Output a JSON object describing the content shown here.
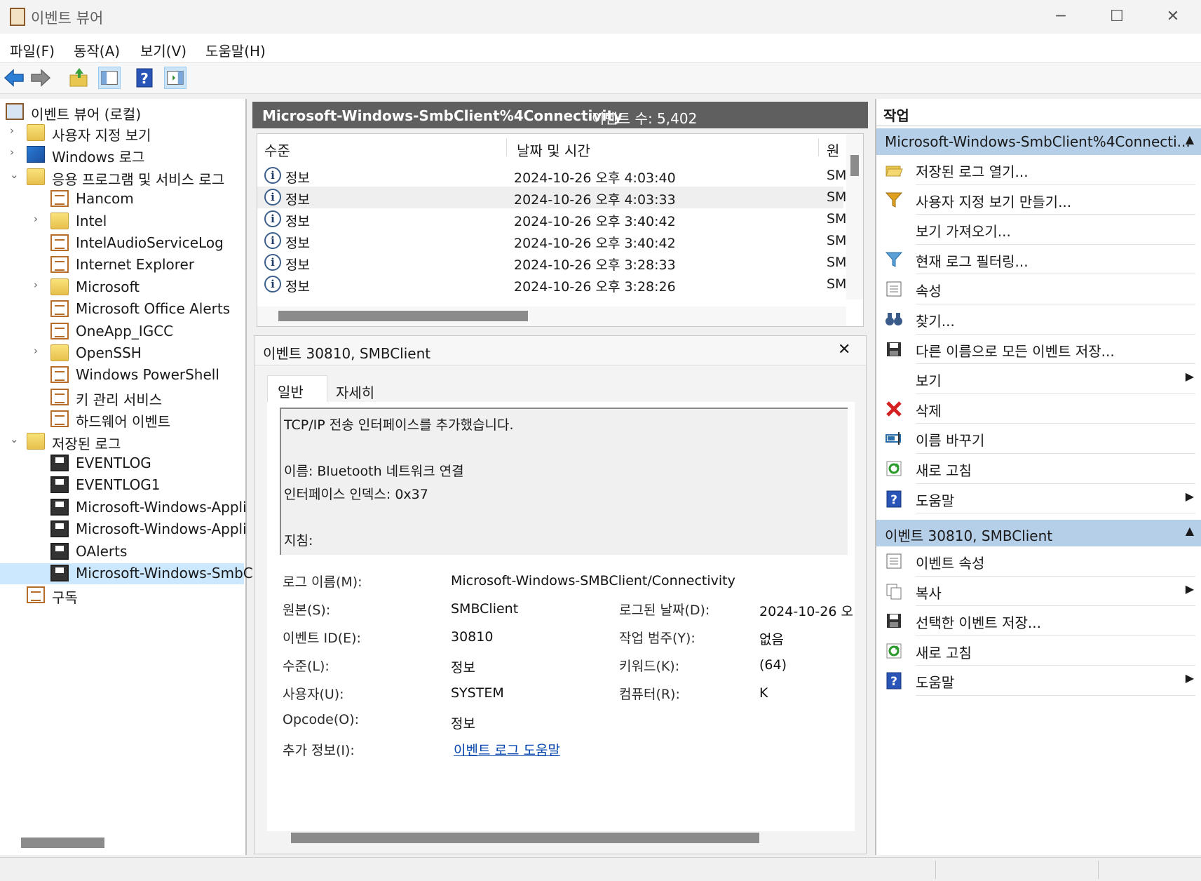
{
  "window": {
    "title": "이벤트 뷰어",
    "controls": [
      "─",
      "☐",
      "✕"
    ]
  },
  "menu": [
    "파일(F)",
    "동작(A)",
    "보기(V)",
    "도움말(H)"
  ],
  "tree": {
    "root": "이벤트 뷰어 (로컬)",
    "items": [
      {
        "label": "사용자 지정 보기",
        "expander": "›",
        "icon": "folder-icon"
      },
      {
        "label": "Windows 로그",
        "expander": "›",
        "icon": "windows-logs-icon"
      },
      {
        "label": "응용 프로그램 및 서비스 로그",
        "expander": "⌄",
        "icon": "folder-icon"
      },
      {
        "label": "Hancom",
        "expander": "",
        "icon": "log-icon"
      },
      {
        "label": "Intel",
        "expander": "›",
        "icon": "folder-icon"
      },
      {
        "label": "IntelAudioServiceLog",
        "expander": "",
        "icon": "log-icon"
      },
      {
        "label": "Internet Explorer",
        "expander": "",
        "icon": "log-icon"
      },
      {
        "label": "Microsoft",
        "expander": "›",
        "icon": "folder-icon"
      },
      {
        "label": "Microsoft Office Alerts",
        "expander": "",
        "icon": "log-icon"
      },
      {
        "label": "OneApp_IGCC",
        "expander": "",
        "icon": "log-icon"
      },
      {
        "label": "OpenSSH",
        "expander": "›",
        "icon": "folder-icon"
      },
      {
        "label": "Windows PowerShell",
        "expander": "",
        "icon": "log-icon"
      },
      {
        "label": "키 관리 서비스",
        "expander": "",
        "icon": "log-icon"
      },
      {
        "label": "하드웨어 이벤트",
        "expander": "",
        "icon": "log-icon"
      },
      {
        "label": "저장된 로그",
        "expander": "⌄",
        "icon": "folder-icon"
      },
      {
        "label": "EVENTLOG",
        "expander": "",
        "icon": "saved-log-icon"
      },
      {
        "label": "EVENTLOG1",
        "expander": "",
        "icon": "saved-log-icon"
      },
      {
        "label": "Microsoft-Windows-Appli",
        "expander": "",
        "icon": "saved-log-icon"
      },
      {
        "label": "Microsoft-Windows-Appli",
        "expander": "",
        "icon": "saved-log-icon"
      },
      {
        "label": "OAlerts",
        "expander": "",
        "icon": "saved-log-icon"
      },
      {
        "label": "Microsoft-Windows-SmbC",
        "expander": "",
        "icon": "saved-log-icon"
      },
      {
        "label": "구독",
        "expander": "",
        "icon": "subscriptions-icon"
      }
    ]
  },
  "log_header": {
    "name": "Microsoft-Windows-SmbClient%4Connectivity",
    "count": "이벤트 수: 5,402"
  },
  "grid": {
    "columns": [
      "수준",
      "날짜 및 시간",
      "원"
    ],
    "rows": [
      {
        "level": "정보",
        "datetime": "2024-10-26 오후 4:03:40",
        "source": "SM"
      },
      {
        "level": "정보",
        "datetime": "2024-10-26 오후 4:03:33",
        "source": "SM"
      },
      {
        "level": "정보",
        "datetime": "2024-10-26 오후 3:40:42",
        "source": "SM"
      },
      {
        "level": "정보",
        "datetime": "2024-10-26 오후 3:40:42",
        "source": "SM"
      },
      {
        "level": "정보",
        "datetime": "2024-10-26 오후 3:28:33",
        "source": "SM"
      },
      {
        "level": "정보",
        "datetime": "2024-10-26 오후 3:28:26",
        "source": "SM"
      }
    ]
  },
  "detail": {
    "title": "이벤트 30810, SMBClient",
    "close": "✕",
    "tabs": [
      "일반",
      "자세히"
    ],
    "message": [
      "TCP/IP 전송 인터페이스를 추가했습니다.",
      "",
      "이름: Bluetooth 네트워크 연결",
      "인터페이스 인덱스: 0x37",
      "",
      "지침:"
    ],
    "fields": {
      "log_name_label": "로그 이름(M):",
      "log_name": "Microsoft-Windows-SMBClient/Connectivity",
      "source_label": "원본(S):",
      "source": "SMBClient",
      "logged_label": "로그된 날짜(D):",
      "logged": "2024-10-26 오",
      "event_id_label": "이벤트 ID(E):",
      "event_id": "30810",
      "task_label": "작업 범주(Y):",
      "task": "없음",
      "level_label": "수준(L):",
      "level": "정보",
      "keywords_label": "키워드(K):",
      "keywords": "(64)",
      "user_label": "사용자(U):",
      "user": "SYSTEM",
      "computer_label": "컴퓨터(R):",
      "computer": "K",
      "opcode_label": "Opcode(O):",
      "opcode": "정보",
      "more_info_label": "추가 정보(I):",
      "more_info": "이벤트 로그 도움말"
    }
  },
  "actions": {
    "title": "작업",
    "section1": "Microsoft-Windows-SmbClient%4Connecti...",
    "items1": [
      {
        "label": "저장된 로그 열기...",
        "icon": "open-folder-icon",
        "arrow": ""
      },
      {
        "label": "사용자 지정 보기 만들기...",
        "icon": "filter-create-icon",
        "arrow": ""
      },
      {
        "label": "보기 가져오기...",
        "icon": "",
        "arrow": ""
      },
      {
        "label": "현재 로그 필터링...",
        "icon": "filter-icon",
        "arrow": ""
      },
      {
        "label": "속성",
        "icon": "properties-icon",
        "arrow": ""
      },
      {
        "label": "찾기...",
        "icon": "binoculars-icon",
        "arrow": ""
      },
      {
        "label": "다른 이름으로 모든 이벤트 저장...",
        "icon": "save-icon",
        "arrow": ""
      },
      {
        "label": "보기",
        "icon": "",
        "arrow": "▶"
      },
      {
        "label": "삭제",
        "icon": "delete-icon",
        "arrow": ""
      },
      {
        "label": "이름 바꾸기",
        "icon": "rename-icon",
        "arrow": ""
      },
      {
        "label": "새로 고침",
        "icon": "refresh-icon",
        "arrow": ""
      },
      {
        "label": "도움말",
        "icon": "help-icon",
        "arrow": "▶"
      }
    ],
    "section2": "이벤트 30810, SMBClient",
    "items2": [
      {
        "label": "이벤트 속성",
        "icon": "properties-icon",
        "arrow": ""
      },
      {
        "label": "복사",
        "icon": "copy-icon",
        "arrow": "▶"
      },
      {
        "label": "선택한 이벤트 저장...",
        "icon": "save-icon",
        "arrow": ""
      },
      {
        "label": "새로 고침",
        "icon": "refresh-icon",
        "arrow": ""
      },
      {
        "label": "도움말",
        "icon": "help-icon",
        "arrow": "▶"
      }
    ]
  },
  "colors": {
    "selection": "#cce8ff",
    "header_dark": "#5f5f5f",
    "action_section": "#b6cfe8",
    "link": "#0645ad"
  }
}
